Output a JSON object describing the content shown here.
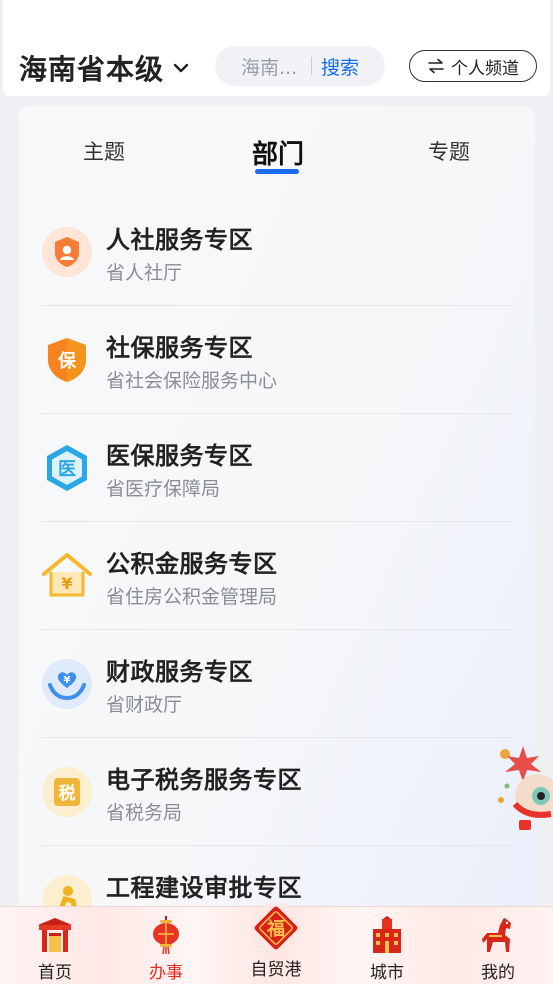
{
  "header": {
    "region": "海南省本级",
    "search_placeholder": "海南...",
    "search_button": "搜索",
    "channel_button": "个人频道",
    "channel_icon": "swap-arrows-icon"
  },
  "tabs": [
    {
      "label": "主题",
      "active": false
    },
    {
      "label": "部门",
      "active": true
    },
    {
      "label": "专题",
      "active": false
    }
  ],
  "departments": [
    {
      "title": "人社服务专区",
      "subtitle": "省人社厅",
      "icon": "person-badge-icon",
      "color": "#f57d37"
    },
    {
      "title": "社保服务专区",
      "subtitle": "省社会保险服务中心",
      "icon": "social-security-shield-icon",
      "color": "#f5841f"
    },
    {
      "title": "医保服务专区",
      "subtitle": "省医疗保障局",
      "icon": "medical-insurance-hexagon-icon",
      "color": "#2aa7e6"
    },
    {
      "title": "公积金服务专区",
      "subtitle": "省住房公积金管理局",
      "icon": "housing-fund-house-icon",
      "color": "#f5b82e"
    },
    {
      "title": "财政服务专区",
      "subtitle": "省财政厅",
      "icon": "finance-hands-heart-icon",
      "color": "#3d8ff0"
    },
    {
      "title": "电子税务服务专区",
      "subtitle": "省税务局",
      "icon": "tax-seal-icon",
      "color": "#e8a524"
    },
    {
      "title": "工程建设审批专区",
      "subtitle": "",
      "icon": "construction-worker-icon",
      "color": "#f2b21e"
    }
  ],
  "bottom_nav": [
    {
      "label": "首页",
      "icon": "gate-icon",
      "active": false
    },
    {
      "label": "办事",
      "icon": "lantern-icon",
      "active": true
    },
    {
      "label": "自贸港",
      "icon": "fu-diamond-icon",
      "active": false
    },
    {
      "label": "城市",
      "icon": "city-building-icon",
      "active": false
    },
    {
      "label": "我的",
      "icon": "horse-icon",
      "active": false
    }
  ],
  "fu_character": "福"
}
